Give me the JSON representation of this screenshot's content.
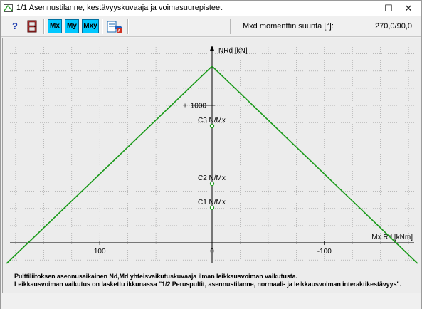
{
  "window": {
    "title": "1/1  Asennustilanne, kestävyyskuvaaja ja voimasuurepisteet",
    "minimize_glyph": "—",
    "maximize_glyph": "☐",
    "close_glyph": "✕"
  },
  "toolbar": {
    "help_label": "?",
    "mx_label": "Mx",
    "my_label": "My",
    "mxy_label": "Mxy",
    "direction_label": "Mxd momenttin suunta [°]:",
    "direction_value": "270,0/90,0"
  },
  "chart_data": {
    "type": "line",
    "title": "",
    "xlabel": "Mx.Rd [kNm]",
    "ylabel": "NRd [kN]",
    "x_axis_reversed": true,
    "xlim": [
      180,
      -180
    ],
    "ylim": [
      -150,
      1425
    ],
    "x_ticks": [
      {
        "value": 100,
        "label": "100"
      },
      {
        "value": 0,
        "label": "0"
      },
      {
        "value": -100,
        "label": "-100"
      }
    ],
    "y_ticks": [
      {
        "value": 1000,
        "label": "1000"
      }
    ],
    "grid": true,
    "series": [
      {
        "color": "#1a9a1a",
        "x": [
          183,
          0,
          -183
        ],
        "y": [
          -150,
          1285,
          -150
        ]
      }
    ],
    "points": [
      {
        "label": "C3 N/Mx",
        "x": 0,
        "y": 850
      },
      {
        "label": "C2 N/Mx",
        "x": 0,
        "y": 430
      },
      {
        "label": "C1 N/Mx",
        "x": 0,
        "y": 255
      }
    ]
  },
  "notes": {
    "line1": "Pulttiliitoksen asennusaikainen Nd,Md yhteisvaikutuskuvaaja ilman leikkausvoiman vaikutusta.",
    "line2": "Leikkausvoiman vaikutus on laskettu ikkunassa \"1/2 Peruspultit, asennustilanne, normaali- ja leikkausvoiman  interaktikestävyys\"."
  }
}
